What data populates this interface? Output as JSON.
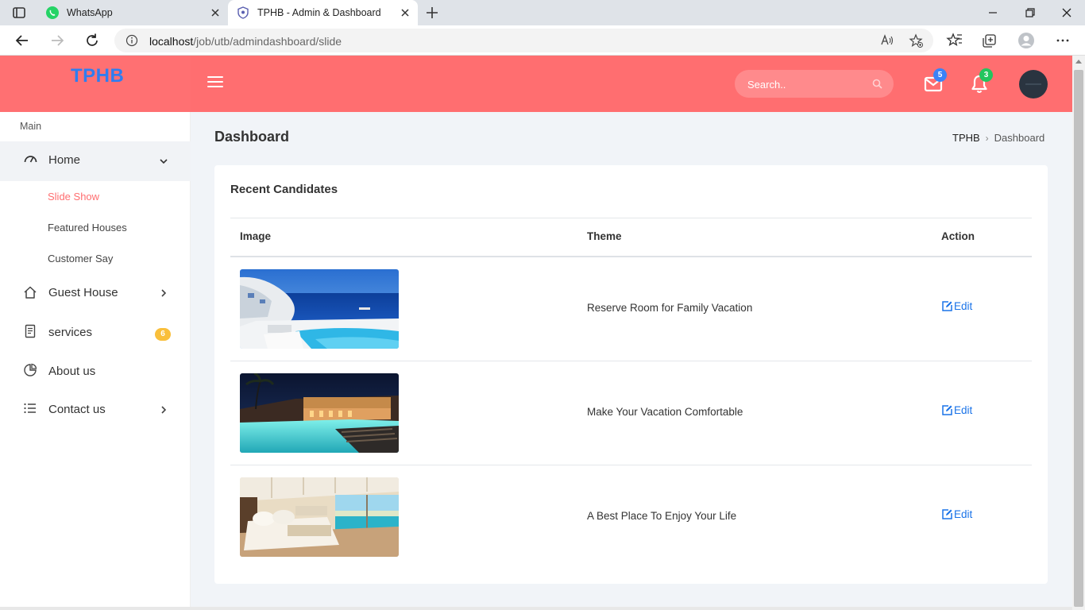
{
  "browser": {
    "tabs": [
      {
        "title": "WhatsApp",
        "active": false,
        "icon": "whatsapp-icon"
      },
      {
        "title": "TPHB - Admin & Dashboard",
        "active": true,
        "icon": "shield-icon"
      }
    ],
    "url_host": "localhost",
    "url_path": "/job/utb/admindashboard/slide"
  },
  "header": {
    "logo": "TPHB",
    "search_placeholder": "Search..",
    "messages_count": "5",
    "notifications_count": "3",
    "colors": {
      "header_bg": "#ff6e70",
      "logo": "#2f7df0",
      "messages_badge": "#3b82f6",
      "notifications_badge": "#22c55e"
    }
  },
  "sidebar": {
    "section_title": "Main",
    "home": {
      "label": "Home",
      "icon": "dashboard-gauge-icon"
    },
    "home_subitems": [
      {
        "label": "Slide Show",
        "active": true
      },
      {
        "label": "Featured Houses",
        "active": false
      },
      {
        "label": "Customer Say",
        "active": false
      }
    ],
    "items": [
      {
        "label": "Guest House",
        "icon": "home-icon",
        "has_chevron": true
      },
      {
        "label": "services",
        "icon": "document-icon",
        "badge": "6"
      },
      {
        "label": "About us",
        "icon": "pie-chart-icon"
      },
      {
        "label": "Contact us",
        "icon": "list-icon",
        "has_chevron": true
      }
    ],
    "active_color": "#ff6e70",
    "badge_color": "#f9bf3b"
  },
  "main": {
    "page_title": "Dashboard",
    "breadcrumb": {
      "home": "TPHB",
      "current": "Dashboard"
    },
    "card_title": "Recent Candidates",
    "columns": [
      "Image",
      "Theme",
      "Action"
    ],
    "rows": [
      {
        "image": "santorini-pool-sea-view-photo",
        "theme": "Reserve Room for Family Vacation",
        "action": "Edit"
      },
      {
        "image": "hotel-pool-at-night-photo",
        "theme": "Make Your Vacation Comfortable",
        "action": "Edit"
      },
      {
        "image": "bedroom-ocean-view-photo",
        "theme": "A Best Place To Enjoy Your Life",
        "action": "Edit"
      }
    ],
    "edit_color": "#1a73e8"
  }
}
